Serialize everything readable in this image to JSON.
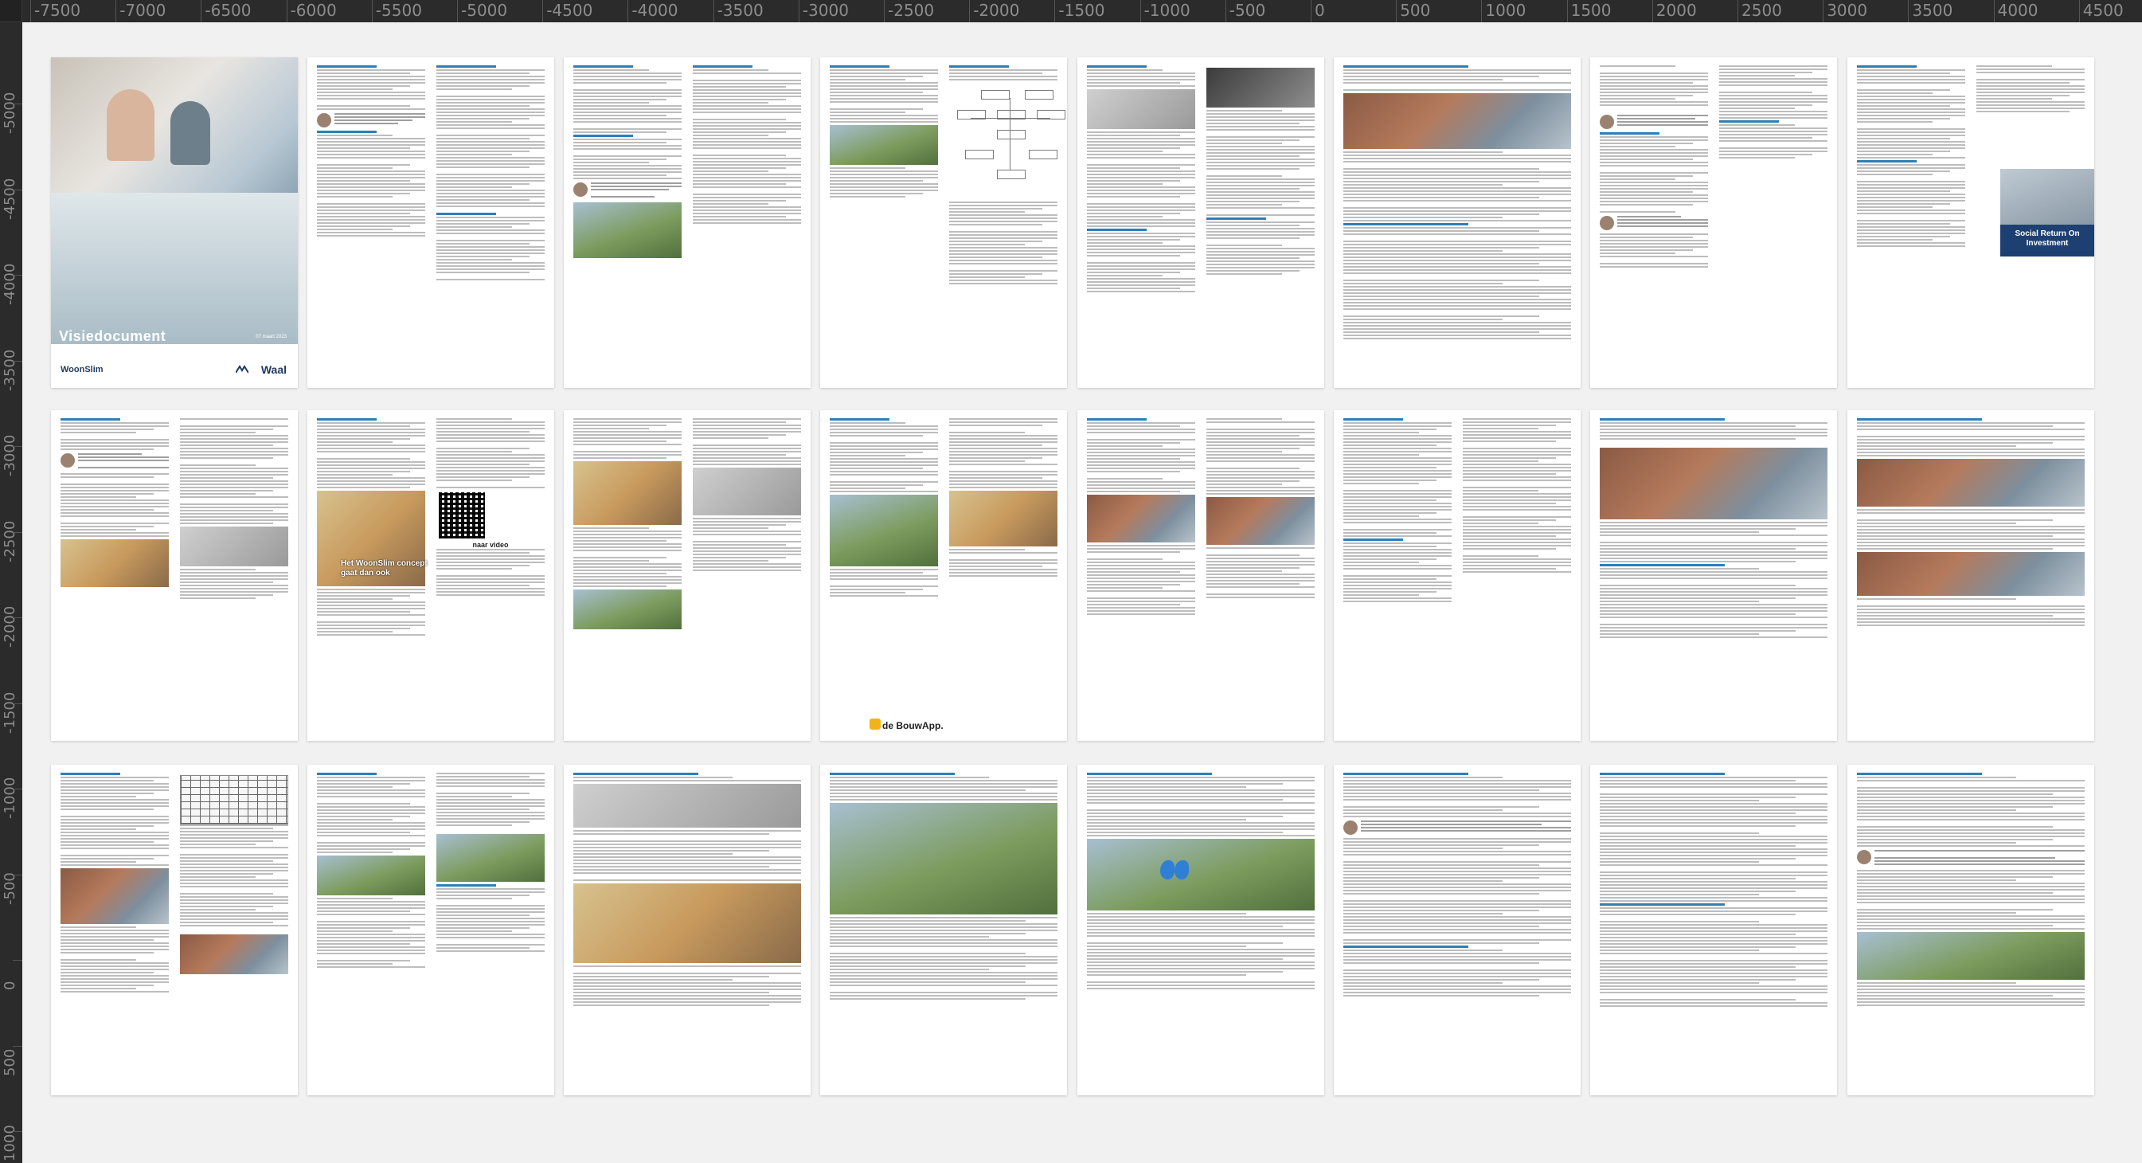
{
  "ruler": {
    "h_ticks": [
      "-7500",
      "-7000",
      "-6500",
      "-6000",
      "-5500",
      "-5000",
      "-4500",
      "-4000",
      "-3500",
      "-3000",
      "-2500",
      "-2000",
      "-1500",
      "-1000",
      "-500",
      "0",
      "500",
      "1000",
      "1500",
      "2000",
      "2500",
      "3000",
      "3500",
      "4000",
      "4500"
    ],
    "v_ticks": [
      "-5000",
      "-4500",
      "-4000",
      "-3500",
      "-3000",
      "-2500",
      "-2000",
      "-1500",
      "-1000",
      "-500",
      "0",
      "500",
      "1000"
    ]
  },
  "cover": {
    "title": "Visiedocument",
    "date": "07 maart 2023",
    "logo_left": "WoonSlim",
    "logo_right": "Waal"
  },
  "page_texts": {
    "qr_label": "naar video",
    "video_overlay": "Het WoonSlim concept gaat dan ook",
    "sroi": "Social Return On Investment",
    "bouwapp": "de BouwApp."
  }
}
